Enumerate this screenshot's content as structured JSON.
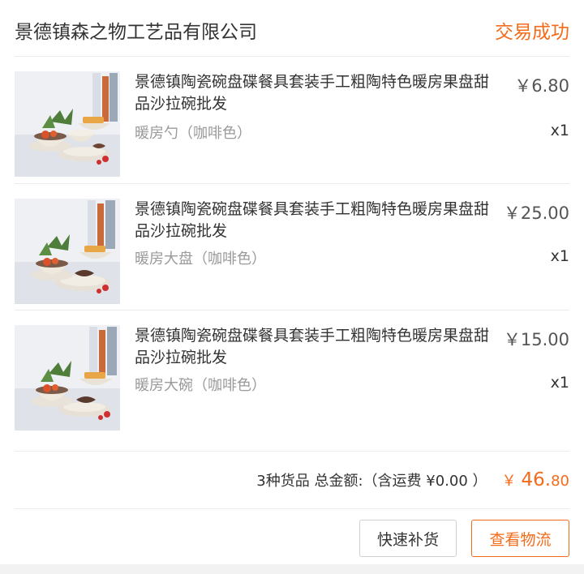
{
  "shop": {
    "name": "景德镇森之物工艺品有限公司",
    "status": "交易成功"
  },
  "items": [
    {
      "title": "景德镇陶瓷碗盘碟餐具套装手工粗陶特色暖房果盘甜品沙拉碗批发",
      "sku": "暖房勺（咖啡色）",
      "price": "￥6.80",
      "qty": "x1"
    },
    {
      "title": "景德镇陶瓷碗盘碟餐具套装手工粗陶特色暖房果盘甜品沙拉碗批发",
      "sku": "暖房大盘（咖啡色）",
      "price": "￥25.00",
      "qty": "x1"
    },
    {
      "title": "景德镇陶瓷碗盘碟餐具套装手工粗陶特色暖房果盘甜品沙拉碗批发",
      "sku": "暖房大碗（咖啡色）",
      "price": "￥15.00",
      "qty": "x1"
    }
  ],
  "summary": {
    "text": "3种货品  总金额:（含运费 ¥0.00 ）",
    "currency": "￥",
    "total_int": "46.",
    "total_dec": "80"
  },
  "buttons": {
    "restock": "快速补货",
    "logistics": "查看物流"
  },
  "colors": {
    "accent": "#f46b1b",
    "sku_gray": "#9a9a9a",
    "divider": "#ececec"
  }
}
